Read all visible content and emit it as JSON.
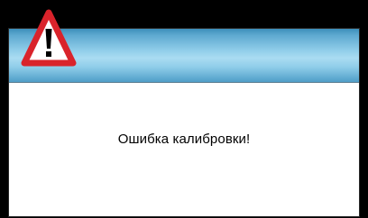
{
  "dialog": {
    "icon": "warning-triangle-icon",
    "message": "Ошибка калибровки!"
  },
  "colors": {
    "background": "#000000",
    "title_bar_light": "#aadcf2",
    "title_bar_dark": "#3c8fbb",
    "warning_red": "#d9232b",
    "warning_fill": "#ffffff",
    "message_text": "#000000"
  }
}
